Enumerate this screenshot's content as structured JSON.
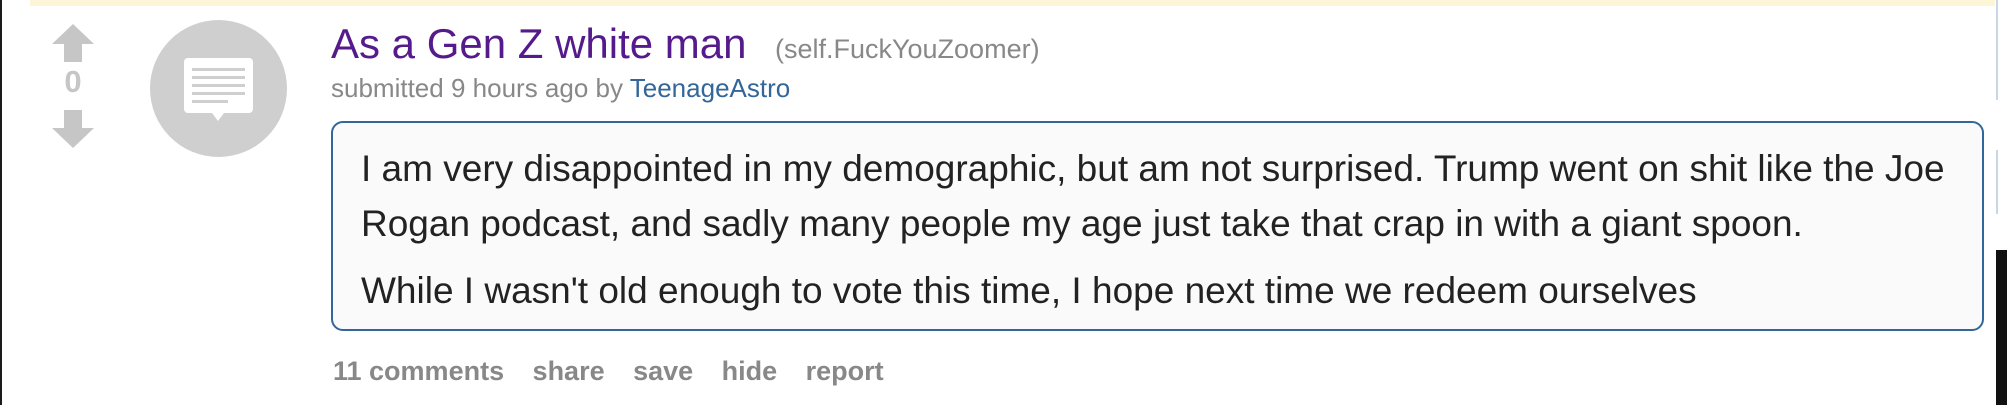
{
  "post": {
    "score": "0",
    "title": "As a Gen Z white man",
    "domain": "(self.FuckYouZoomer)",
    "tagline": {
      "prefix": "submitted",
      "time": "9 hours ago",
      "by": "by",
      "author": "TeenageAstro"
    },
    "body": [
      "I am very disappointed in my demographic, but am not surprised. Trump went on shit like the Joe Rogan podcast, and sadly many people my age just take that crap in with a giant spoon.",
      "While I wasn't old enough to vote this time, I hope next time we redeem ourselves"
    ],
    "buttons": {
      "comments": "11 comments",
      "share": "share",
      "save": "save",
      "hide": "hide",
      "report": "report"
    }
  },
  "icons": {
    "upvote": "upvote-arrow-icon",
    "downvote": "downvote-arrow-icon",
    "thumbnail": "self-post-text-icon"
  },
  "colors": {
    "title_visited": "#551a8b",
    "author_link": "#336699",
    "expando_border": "#336699",
    "muted_text": "#888888",
    "vote_arrow": "#c6c6c6"
  }
}
